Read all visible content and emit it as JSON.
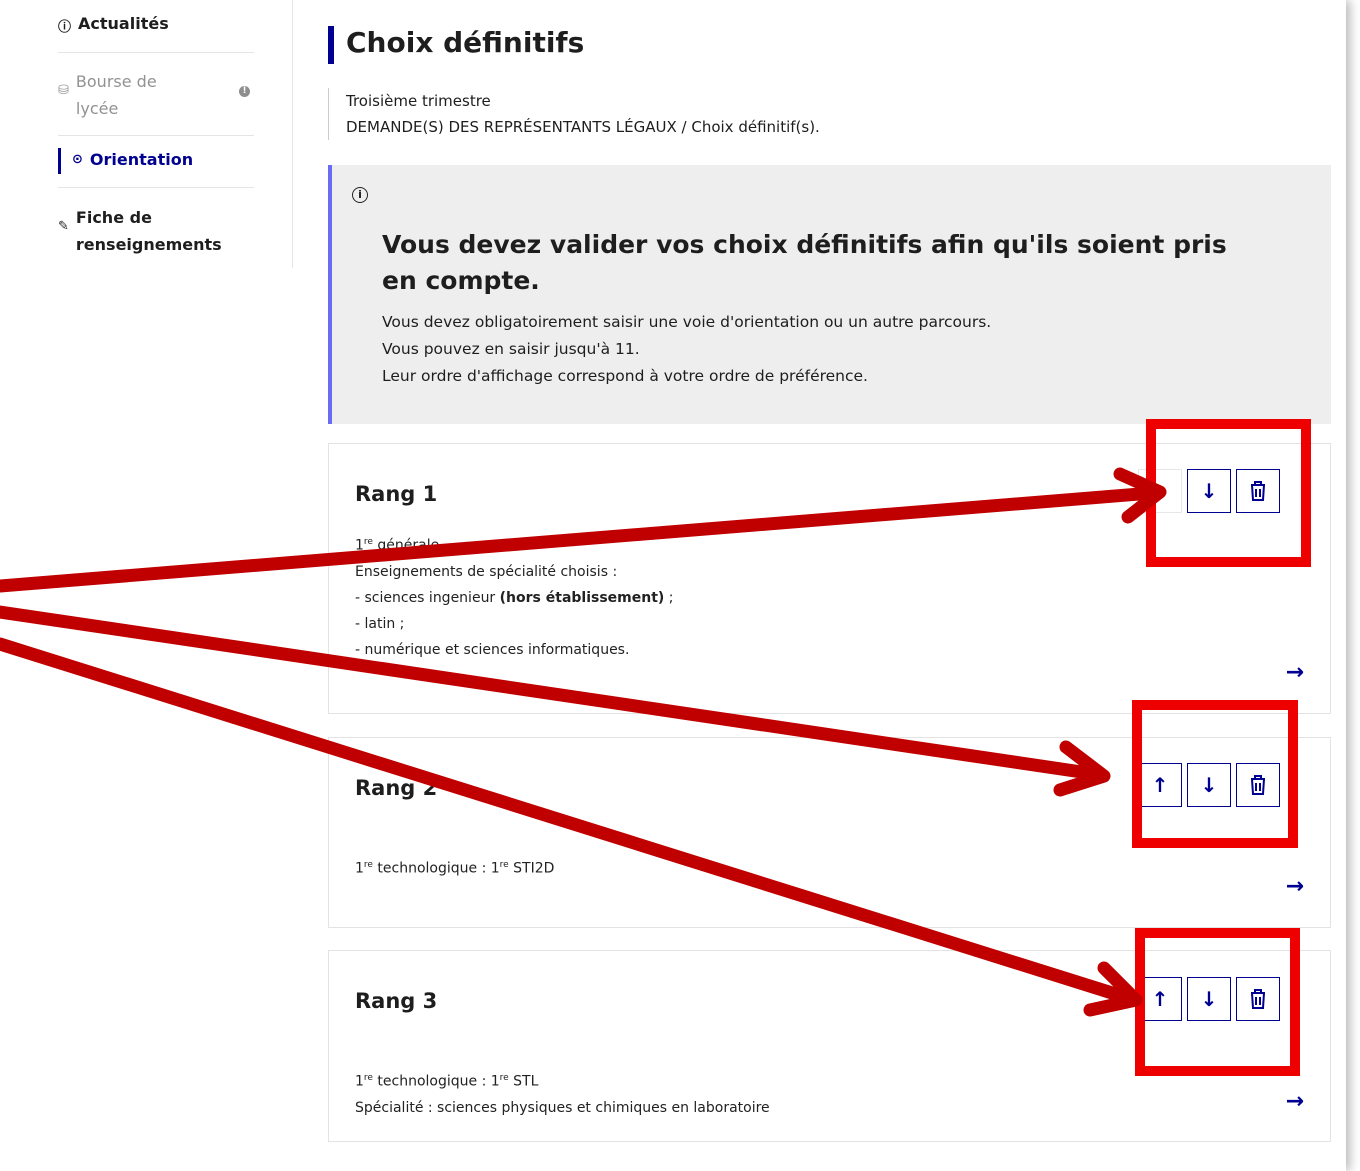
{
  "sidebar": {
    "items": [
      {
        "id": "actualites",
        "label": "Actualités",
        "icon": "info-icon"
      },
      {
        "id": "bourse",
        "label_line1": "Bourse de",
        "label_line2": "lycée",
        "icon": "coins-icon"
      },
      {
        "id": "orientation",
        "label": "Orientation",
        "icon": "compass-icon",
        "active": true
      },
      {
        "id": "fiche",
        "label_line1": "Fiche de",
        "label_line2": "renseignements",
        "icon": "pen-icon"
      }
    ]
  },
  "main": {
    "title": "Choix définitifs",
    "period": "Troisième trimestre",
    "breadcrumb": "DEMANDE(S) DES REPRÉSENTANTS LÉGAUX / Choix définitif(s).",
    "alert": {
      "title": "Vous devez valider vos choix définitifs afin qu'ils soient pris en compte.",
      "lines": [
        "Vous devez obligatoirement saisir une voie d'orientation ou un autre parcours.",
        "Vous pouvez en saisir jusqu'à 11.",
        "Leur ordre d'affichage correspond à votre ordre de préférence."
      ]
    },
    "cards": [
      {
        "title": "Rang 1",
        "voie": "générale",
        "spec_header": "Enseignements de spécialité choisis :",
        "spec1": "- sciences ingenieur ",
        "spec1_bold": "(hors établissement)",
        "spec1_end": " ;",
        "spec2": "- latin ;",
        "spec3": "- numérique et sciences informatiques."
      },
      {
        "title": "Rang 2",
        "line1_a": " technologique : 1",
        "line1_b": " STI2D"
      },
      {
        "title": "Rang 3",
        "line1_a": " technologique : 1",
        "line1_b": " STL",
        "line2": "Spécialité : sciences physiques et chimiques en laboratoire"
      }
    ],
    "ordinal": {
      "number": "1",
      "suffix": "re"
    },
    "icons": {
      "up": "↑",
      "down": "↓",
      "next": "→"
    }
  },
  "colors": {
    "accent": "#000091",
    "highlight": "#ee0000",
    "annotation_arrow": "#c00000",
    "alert_border": "#6a6af4"
  }
}
